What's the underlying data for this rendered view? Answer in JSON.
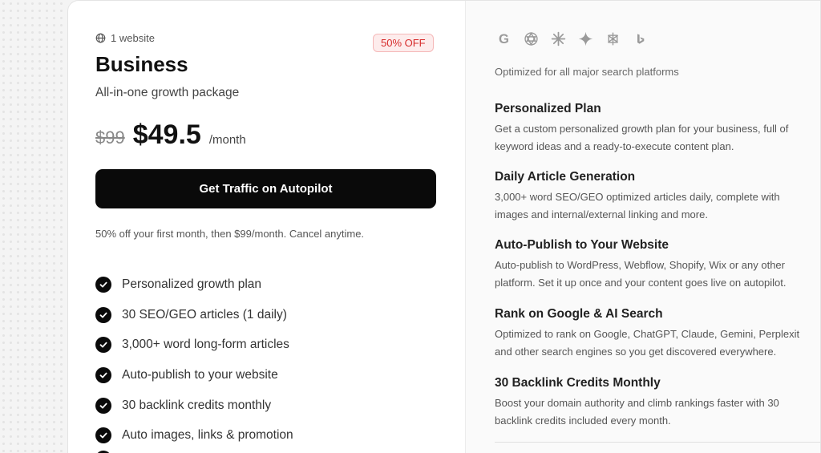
{
  "plan": {
    "website_count": "1 website",
    "discount_badge": "50% OFF",
    "name": "Business",
    "subtitle": "All-in-one growth package",
    "old_price": "$99",
    "new_price": "$49.5",
    "period": "/month",
    "cta_label": "Get Traffic on Autopilot",
    "note": "50% off your first month, then $99/month. Cancel anytime.",
    "features": [
      "Personalized growth plan",
      "30 SEO/GEO articles (1 daily)",
      "3,000+ word long-form articles",
      "Auto-publish to your website",
      "30 backlink credits monthly",
      "Auto images, links & promotion"
    ]
  },
  "platforms": {
    "icons": [
      "google-icon",
      "openai-icon",
      "claude-icon",
      "gemini-icon",
      "perplexity-icon",
      "bing-icon"
    ],
    "caption": "Optimized for all major search platforms"
  },
  "details": [
    {
      "title": "Personalized Plan",
      "line1": "Get a custom personalized growth plan for your business, full of",
      "line2": "keyword ideas and a ready-to-execute content plan."
    },
    {
      "title": "Daily Article Generation",
      "line1": "3,000+ word SEO/GEO optimized articles daily, complete with",
      "line2": "images and internal/external linking and more."
    },
    {
      "title": "Auto-Publish to Your Website",
      "line1": "Auto-publish to WordPress, Webflow, Shopify, Wix or any other",
      "line2": "platform. Set it up once and your content goes live on autopilot."
    },
    {
      "title": "Rank on Google & AI Search",
      "line1": "Optimized to rank on Google, ChatGPT, Claude, Gemini, Perplexit",
      "line2": "and other search engines so you get discovered everywhere."
    },
    {
      "title": "30 Backlink Credits Monthly",
      "line1": "Boost your domain authority and climb rankings faster with 30",
      "line2": "backlink credits included every month."
    }
  ],
  "colors": {
    "accent": "#0a0a0a",
    "badge_text": "#d62b2b",
    "badge_bg": "#fdecec"
  }
}
